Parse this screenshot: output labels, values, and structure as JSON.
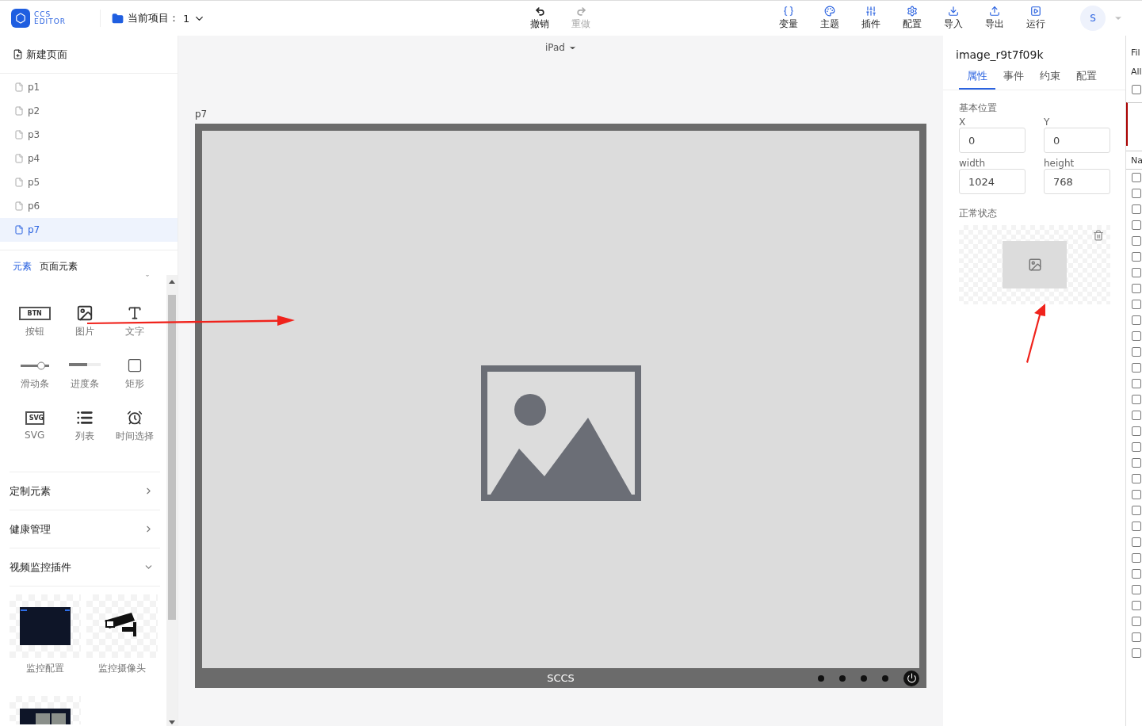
{
  "header": {
    "logo_lines": [
      "CCS",
      "EDITOR"
    ],
    "project_label": "当前项目：",
    "project_value": "1",
    "history": [
      {
        "kind": "undo",
        "label": "撤销",
        "disabled": false
      },
      {
        "kind": "redo",
        "label": "重做",
        "disabled": true
      }
    ],
    "tools": [
      {
        "kind": "var",
        "label": "变量"
      },
      {
        "kind": "theme",
        "label": "主题"
      },
      {
        "kind": "plugin",
        "label": "插件"
      },
      {
        "kind": "config",
        "label": "配置"
      },
      {
        "kind": "import",
        "label": "导入"
      },
      {
        "kind": "export",
        "label": "导出"
      },
      {
        "kind": "run",
        "label": "运行"
      }
    ],
    "avatar": "S"
  },
  "sidebar": {
    "new_page": "新建页面",
    "pages": [
      {
        "label": "p1",
        "selected": false
      },
      {
        "label": "p2",
        "selected": false
      },
      {
        "label": "p3",
        "selected": false
      },
      {
        "label": "p4",
        "selected": false
      },
      {
        "label": "p5",
        "selected": false
      },
      {
        "label": "p6",
        "selected": false
      },
      {
        "label": "p7",
        "selected": true
      }
    ],
    "tabs": [
      {
        "label": "元素",
        "selected": true
      },
      {
        "label": "页面元素",
        "selected": false
      }
    ],
    "elements": [
      {
        "kind": "button",
        "glyph": "BTN",
        "label": "按钮"
      },
      {
        "kind": "image",
        "label": "图片"
      },
      {
        "kind": "text",
        "label": "文字"
      },
      {
        "kind": "slider",
        "label": "滑动条"
      },
      {
        "kind": "progress",
        "label": "进度条"
      },
      {
        "kind": "rect",
        "label": "矩形"
      },
      {
        "kind": "svg",
        "glyph": "SVG",
        "label": "SVG"
      },
      {
        "kind": "list",
        "label": "列表"
      },
      {
        "kind": "clock",
        "label": "时间选择"
      }
    ],
    "sections": [
      {
        "label": "定制元素",
        "expanded": false
      },
      {
        "label": "健康管理",
        "expanded": false
      },
      {
        "label": "视频监控插件",
        "expanded": true
      }
    ],
    "plugins": [
      {
        "kind": "screen",
        "label": "监控配置"
      },
      {
        "kind": "camera",
        "label": "监控摄像头"
      },
      {
        "kind": "video"
      }
    ]
  },
  "canvas": {
    "device": "iPad",
    "page": "p7",
    "bar_title": "SCCS"
  },
  "inspector": {
    "title": "image_r9t7f09k",
    "tabs": [
      {
        "label": "属性",
        "selected": true
      },
      {
        "label": "事件",
        "selected": false
      },
      {
        "label": "约束",
        "selected": false
      },
      {
        "label": "配置",
        "selected": false
      }
    ],
    "section": "基本位置",
    "fields": [
      {
        "label": "X",
        "value": "0"
      },
      {
        "label": "Y",
        "value": "0"
      },
      {
        "label": "width",
        "value": "1024"
      },
      {
        "label": "height",
        "value": "768"
      }
    ],
    "state_label": "正常状态"
  },
  "side_strip": {
    "filter": "Fil",
    "all": "All",
    "all_checked": false,
    "column": "Na",
    "rows": [
      {
        "checked": false
      },
      {
        "checked": false
      },
      {
        "checked": false
      },
      {
        "checked": false
      },
      {
        "checked": false
      },
      {
        "checked": false
      },
      {
        "checked": false
      },
      {
        "checked": false
      },
      {
        "checked": false
      },
      {
        "checked": false
      },
      {
        "checked": false
      },
      {
        "checked": false
      },
      {
        "checked": false
      },
      {
        "checked": false
      },
      {
        "checked": false
      },
      {
        "checked": false
      },
      {
        "checked": false
      },
      {
        "checked": false
      },
      {
        "checked": false
      },
      {
        "checked": false
      },
      {
        "checked": false
      },
      {
        "checked": false
      },
      {
        "checked": false
      },
      {
        "checked": false
      },
      {
        "checked": false
      },
      {
        "checked": false
      },
      {
        "checked": false
      },
      {
        "checked": false
      },
      {
        "checked": false
      },
      {
        "checked": false
      },
      {
        "checked": false
      }
    ]
  }
}
